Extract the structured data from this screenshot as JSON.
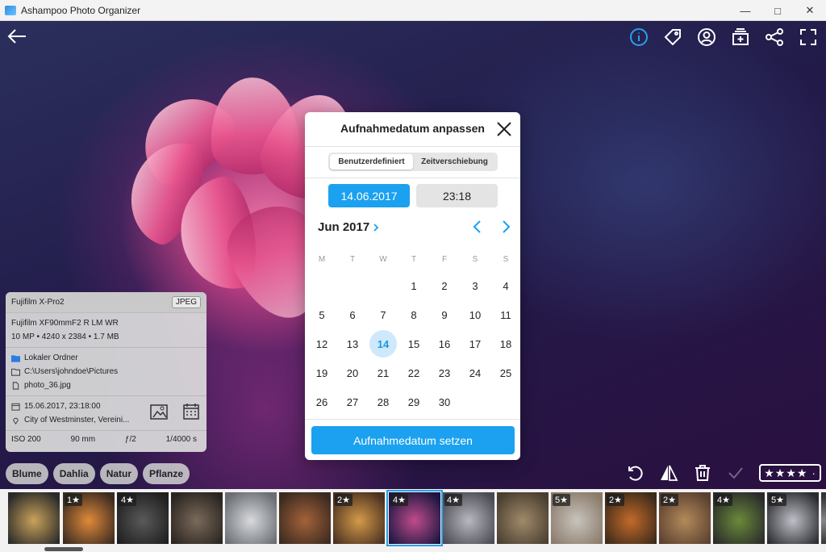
{
  "window": {
    "title": "Ashampoo Photo Organizer",
    "minimize_glyph": "—",
    "maximize_glyph": "□",
    "close_glyph": "✕"
  },
  "info_panel": {
    "camera": "Fujifilm X-Pro2",
    "format": "JPEG",
    "lens": "Fujifilm XF90mmF2 R LM WR",
    "specs": "10 MP • 4240 x 2384 • 1.7 MB",
    "folder_type": "Lokaler Ordner",
    "path": "C:\\Users\\johndoe\\Pictures",
    "filename": "photo_36.jpg",
    "datetime": "15.06.2017, 23:18:00",
    "location": "City of Westminster, Vereini...",
    "iso": "ISO 200",
    "focal": "90 mm",
    "aperture": "ƒ/2",
    "shutter": "1/4000 s"
  },
  "tags": [
    "Blume",
    "Dahlia",
    "Natur",
    "Pflanze"
  ],
  "rating": {
    "value": 4,
    "max": 5,
    "display": "★★★★ ·"
  },
  "dialog": {
    "title": "Aufnahmedatum anpassen",
    "tabs": [
      "Benutzerdefiniert",
      "Zeitverschiebung"
    ],
    "active_tab": "Benutzerdefiniert",
    "date_value": "14.06.2017",
    "time_value": "23:18",
    "month_label": "Jun 2017",
    "weekdays": [
      "M",
      "T",
      "W",
      "T",
      "F",
      "S",
      "S"
    ],
    "weeks": [
      [
        "",
        "",
        "",
        "1",
        "2",
        "3",
        "4"
      ],
      [
        "5",
        "6",
        "7",
        "8",
        "9",
        "10",
        "11"
      ],
      [
        "12",
        "13",
        "14",
        "15",
        "16",
        "17",
        "18"
      ],
      [
        "19",
        "20",
        "21",
        "22",
        "23",
        "24",
        "25"
      ],
      [
        "26",
        "27",
        "28",
        "29",
        "30",
        "",
        ""
      ]
    ],
    "selected_day": "14",
    "submit_label": "Aufnahmedatum setzen"
  },
  "filmstrip": {
    "thumbnails": [
      {
        "rating_label": "",
        "color1": "#c9a35a",
        "color2": "#2a2a2a"
      },
      {
        "rating_label": "1★",
        "color1": "#e08a3a",
        "color2": "#3a2a20"
      },
      {
        "rating_label": "4★",
        "color1": "#5a5a5a",
        "color2": "#1e1e1e"
      },
      {
        "rating_label": "",
        "color1": "#7a6a5a",
        "color2": "#2a2420"
      },
      {
        "rating_label": "",
        "color1": "#d8dade",
        "color2": "#6a6e72"
      },
      {
        "rating_label": "",
        "color1": "#a4623a",
        "color2": "#3a2a20"
      },
      {
        "rating_label": "2★",
        "color1": "#d49a4a",
        "color2": "#4a3020"
      },
      {
        "rating_label": "4★",
        "color1": "#c04c8c",
        "color2": "#1a1640"
      },
      {
        "rating_label": "4★",
        "color1": "#b8b8c0",
        "color2": "#4a4a54"
      },
      {
        "rating_label": "",
        "color1": "#a08a6a",
        "color2": "#4a3e30"
      },
      {
        "rating_label": "5★",
        "color1": "#c8c4bc",
        "color2": "#8a7a6a"
      },
      {
        "rating_label": "2★",
        "color1": "#c46a2a",
        "color2": "#3a2a1a"
      },
      {
        "rating_label": "2★",
        "color1": "#b48a5a",
        "color2": "#5a4030"
      },
      {
        "rating_label": "4★",
        "color1": "#6a8a3a",
        "color2": "#2a2a2a"
      },
      {
        "rating_label": "5★",
        "color1": "#c0c0c8",
        "color2": "#2a2a30"
      },
      {
        "rating_label": "",
        "color1": "#888888",
        "color2": "#333333"
      }
    ]
  },
  "colors": {
    "accent": "#1ba1ef",
    "info_icon_active": "#2b9fe8",
    "folder_icon": "#2a7de1"
  },
  "icons": {
    "back": "arrow-left-icon",
    "info": "info-icon",
    "tag": "tag-icon",
    "people": "face-icon",
    "album": "album-add-icon",
    "share": "share-icon",
    "fullscreen": "fullscreen-icon"
  }
}
